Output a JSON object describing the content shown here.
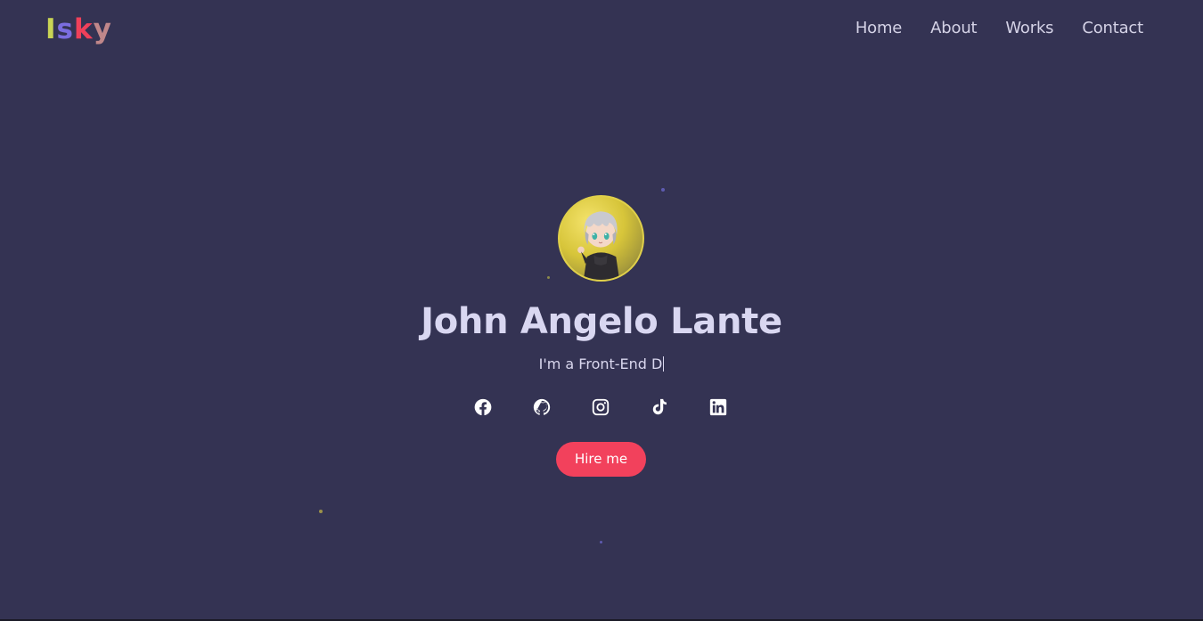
{
  "header": {
    "logo": [
      "I",
      "s",
      "k",
      "y"
    ],
    "logo_colors": [
      "#c9d455",
      "#7b6de0",
      "#f0405a",
      "#c0878a"
    ],
    "nav": [
      {
        "label": "Home"
      },
      {
        "label": "About"
      },
      {
        "label": "Works"
      },
      {
        "label": "Contact"
      }
    ]
  },
  "hero": {
    "name": "John Angelo Lante",
    "tagline": "I'm a Front-End D",
    "hire_button": "Hire me",
    "socials": [
      "facebook-icon",
      "github-icon",
      "instagram-icon",
      "tiktok-icon",
      "linkedin-icon"
    ]
  },
  "colors": {
    "background": "#343353",
    "accent": "#f2415c",
    "heading": "#d9d7f1"
  }
}
